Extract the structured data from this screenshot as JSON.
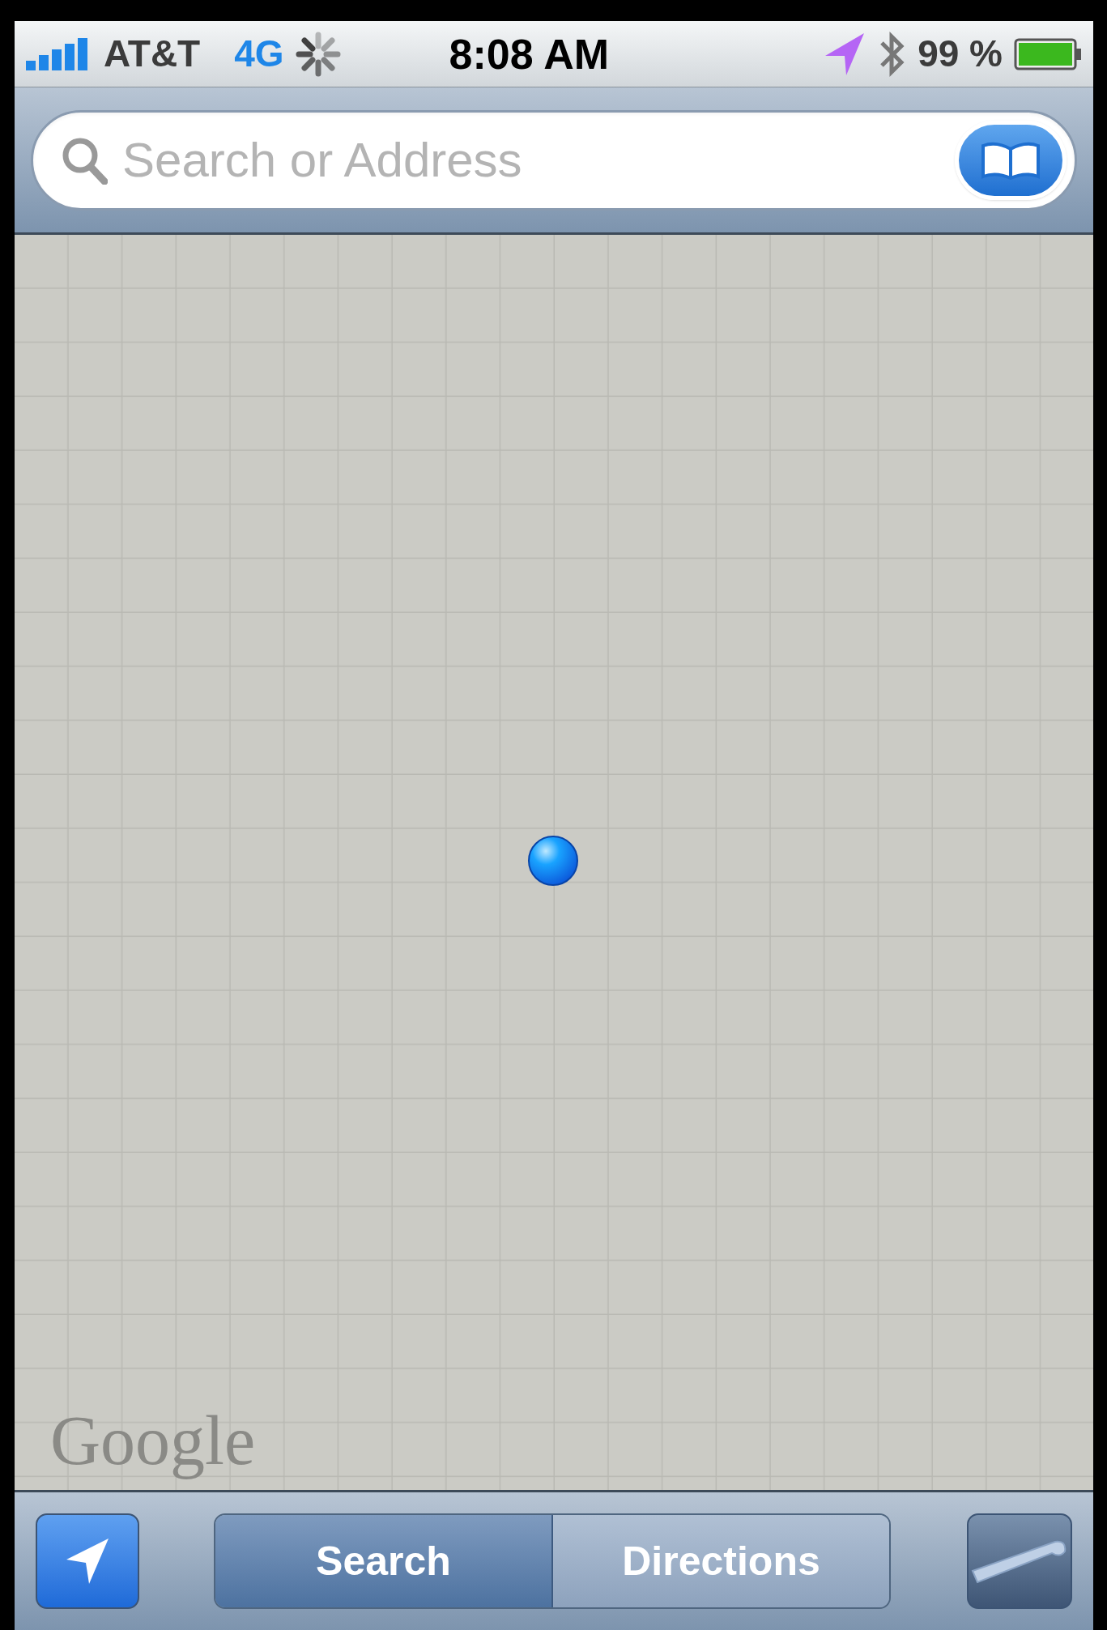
{
  "status_bar": {
    "carrier": "AT&T",
    "network": "4G",
    "time": "8:08 AM",
    "battery": "99 %"
  },
  "search": {
    "placeholder": "Search or Address"
  },
  "map": {
    "logo": "Google"
  },
  "toolbar": {
    "segments": [
      {
        "label": "Search",
        "selected": true
      },
      {
        "label": "Directions",
        "selected": false
      }
    ]
  }
}
